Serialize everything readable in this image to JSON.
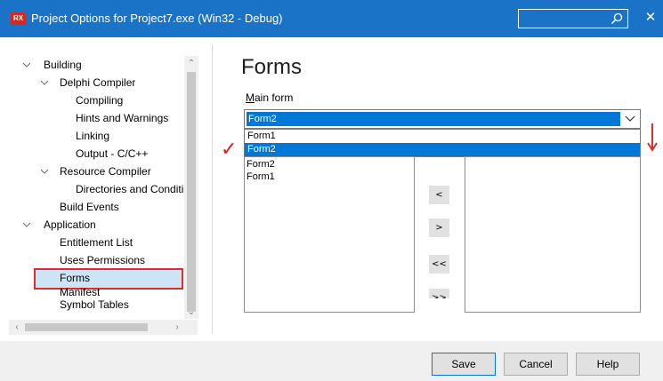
{
  "window": {
    "title": "Project Options for Project7.exe  (Win32 - Debug)",
    "app_icon_text": "RX",
    "accent_color": "#1a73c6"
  },
  "tree": {
    "items": [
      {
        "label": "Building",
        "expanded": true
      },
      {
        "label": "Delphi Compiler",
        "expanded": true
      },
      {
        "label": "Compiling"
      },
      {
        "label": "Hints and Warnings"
      },
      {
        "label": "Linking"
      },
      {
        "label": "Output - C/C++"
      },
      {
        "label": "Resource Compiler",
        "expanded": true
      },
      {
        "label": "Directories and Conditionals"
      },
      {
        "label": "Build Events"
      },
      {
        "label": "Application",
        "expanded": true
      },
      {
        "label": "Entitlement List"
      },
      {
        "label": "Uses Permissions"
      },
      {
        "label": "Forms",
        "selected": true
      },
      {
        "label": "Manifest"
      },
      {
        "label": "Symbol Tables"
      }
    ]
  },
  "page": {
    "heading": "Forms",
    "main_form_label_underlined": "M",
    "main_form_label_rest": "ain form",
    "main_form_value": "Form2",
    "dropdown_options": [
      "Form1",
      "Form2"
    ],
    "dropdown_highlighted": "Form2",
    "auto_create_list": [
      "Form2",
      "Form1"
    ],
    "available_list": [],
    "move_buttons": [
      "<",
      ">",
      "<<",
      ">>"
    ]
  },
  "buttons": {
    "save": "Save",
    "cancel": "Cancel",
    "help": "Help"
  },
  "annotations": {
    "highlight_color": "#e12a2a",
    "check_mark": "✓"
  }
}
